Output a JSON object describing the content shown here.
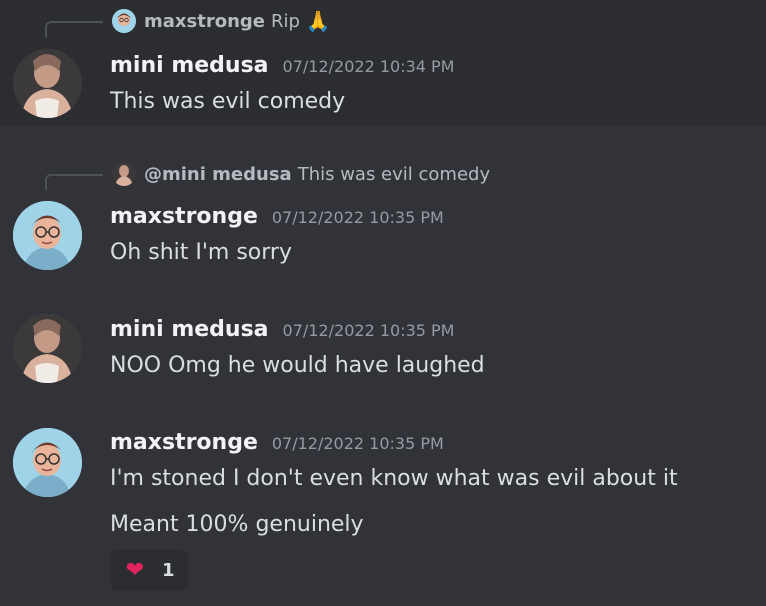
{
  "users": {
    "medusa": {
      "name": "mini medusa",
      "mention": "@mini medusa",
      "avatar_icon": "avatar-photo-icon"
    },
    "max": {
      "name": "maxstronge",
      "avatar_icon": "avatar-cartoon-icon"
    }
  },
  "messages": [
    {
      "author": "mini medusa",
      "time": "07/12/2022 10:34 PM",
      "text": "This was evil comedy",
      "reply": {
        "author": "maxstronge",
        "text": "Rip",
        "emoji": "🙏"
      }
    },
    {
      "author": "maxstronge",
      "time": "07/12/2022 10:35 PM",
      "text": "Oh shit I'm sorry",
      "reply": {
        "author": "@mini medusa",
        "text": "This was evil comedy"
      }
    },
    {
      "author": "mini medusa",
      "time": "07/12/2022 10:35 PM",
      "text": "NOO Omg he would have laughed"
    },
    {
      "author": "maxstronge",
      "time": "07/12/2022 10:35 PM",
      "text": "I'm stoned I don't even know what was evil about it",
      "text2": "Meant 100% genuinely",
      "reaction": {
        "emoji": "❤",
        "count": "1"
      }
    }
  ],
  "colors": {
    "background": "#313338",
    "highlight": "#2b2d31",
    "author": "#f2f3f5",
    "muted": "#949ba4"
  }
}
